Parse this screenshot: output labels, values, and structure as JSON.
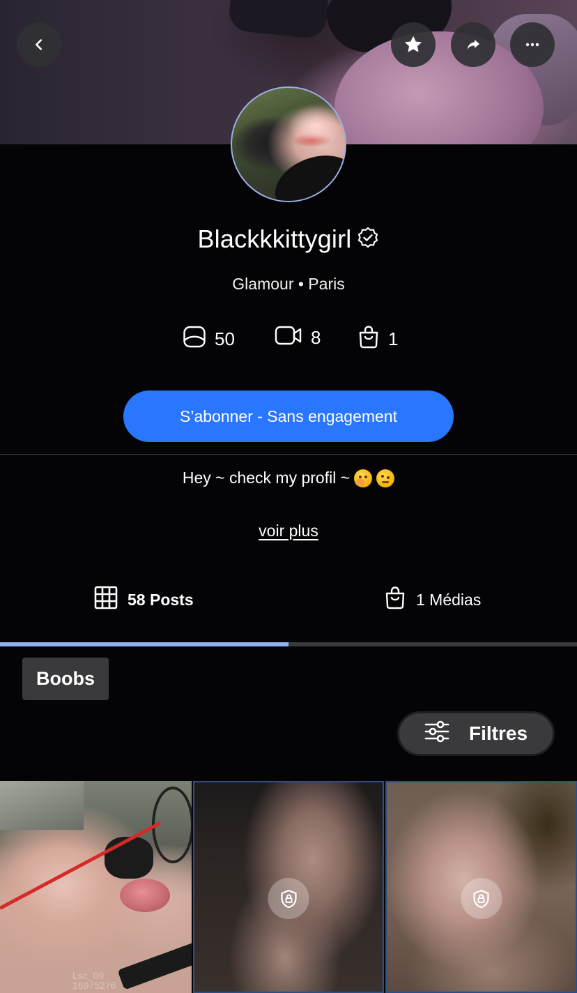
{
  "header": {
    "back_icon": "chevron-left-icon",
    "favorite_icon": "star-icon",
    "share_icon": "share-arrow-icon",
    "more_icon": "more-dots-icon"
  },
  "profile": {
    "name": "Blackkkittygirl",
    "verified_icon": "verified-badge-icon",
    "subtitle": "Glamour • Paris",
    "stats": [
      {
        "icon": "photo-icon",
        "value": "50"
      },
      {
        "icon": "video-icon",
        "value": "8"
      },
      {
        "icon": "shopping-bag-icon",
        "value": "1"
      }
    ],
    "subscribe_label": "S’abonner - Sans engagement",
    "bio_text": "Hey ~ check my profil ~",
    "bio_emojis": [
      "face-with-hand-over-mouth-emoji",
      "woozy-face-emoji"
    ],
    "see_more_label": "voir plus"
  },
  "tabs": [
    {
      "label": "58 Posts",
      "icon": "grid-icon",
      "active": true
    },
    {
      "label": "1 Médias",
      "icon": "shopping-bag-icon",
      "active": false
    }
  ],
  "category_chip": "Boobs",
  "filters_label": "Filtres",
  "grid": {
    "tiles": [
      {
        "locked": false,
        "watermark": "Lsc_09\n16975276"
      },
      {
        "locked": true,
        "icon": "lock-shield-icon"
      },
      {
        "locked": true,
        "icon": "lock-shield-icon"
      }
    ]
  },
  "colors": {
    "background": "#040407",
    "accent_blue": "#2a77ff",
    "tab_indicator": "#8fb2f0",
    "chip_bg": "#3a3a3d"
  }
}
